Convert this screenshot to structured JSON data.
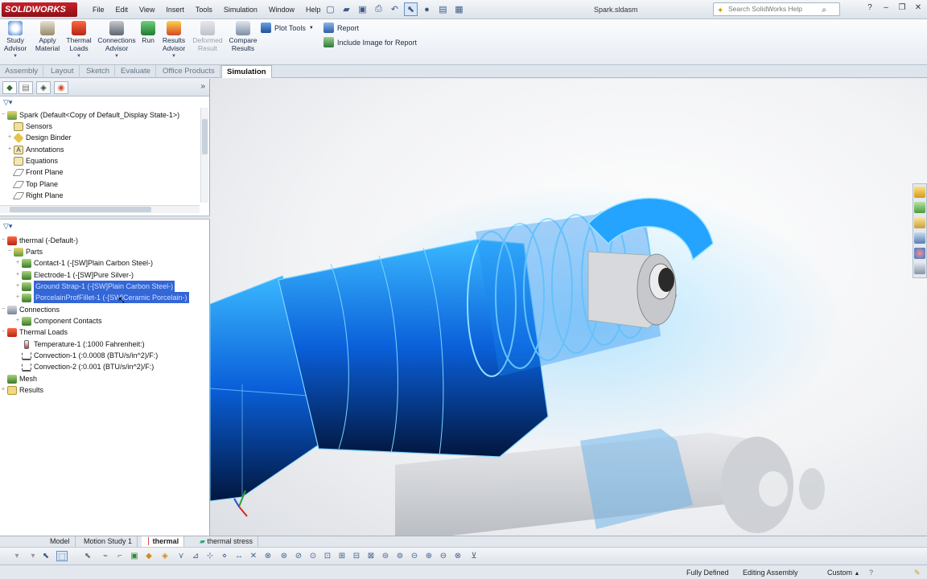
{
  "app": {
    "logo": "SOLIDWORKS",
    "doc_title": "Spark.sldasm"
  },
  "menu": [
    "File",
    "Edit",
    "View",
    "Insert",
    "Tools",
    "Simulation",
    "Window",
    "Help"
  ],
  "search": {
    "placeholder": "Search SolidWorks Help"
  },
  "ribbon": {
    "study_advisor": {
      "l1": "Study",
      "l2": "Advisor"
    },
    "apply_material": {
      "l1": "Apply",
      "l2": "Material"
    },
    "thermal_loads": {
      "l1": "Thermal",
      "l2": "Loads"
    },
    "connections_advisor": {
      "l1": "Connections",
      "l2": "Advisor"
    },
    "run": {
      "l1": "Run"
    },
    "results_advisor": {
      "l1": "Results",
      "l2": "Advisor"
    },
    "deformed_result": {
      "l1": "Deformed",
      "l2": "Result"
    },
    "compare_results": {
      "l1": "Compare",
      "l2": "Results"
    },
    "plot_tools": "Plot Tools",
    "report": "Report",
    "include_image": "Include Image for Report"
  },
  "tabs": [
    "Assembly",
    "Layout",
    "Sketch",
    "Evaluate",
    "Office Products",
    "Simulation"
  ],
  "active_tab": "Simulation",
  "feature_tree": {
    "root": "Spark  (Default<Copy of Default_Display State-1>)",
    "items": [
      "Sensors",
      "Design Binder",
      "Annotations",
      "Equations",
      "Front Plane",
      "Top Plane",
      "Right Plane"
    ]
  },
  "study_tree": {
    "root": "thermal (-Default-)",
    "parts": "Parts",
    "part_items": [
      "Contact-1 (-[SW]Plain Carbon Steel-)",
      "Electrode-1 (-[SW]Pure Silver-)",
      "Ground Strap-1 (-[SW]Plain Carbon Steel-)",
      "PorcelainProfFillet-1 (-[SW]Ceramic Porcelain-)"
    ],
    "connections": "Connections",
    "component_contacts": "Component Contacts",
    "thermal_loads": "Thermal Loads",
    "load_items": [
      "Temperature-1 (:1000 Fahrenheit:)",
      "Convection-1 (:0.0008 (BTU/s/in^2)/F:)",
      "Convection-2 (:0.001 (BTU/s/in^2)/F:)"
    ],
    "mesh": "Mesh",
    "results": "Results"
  },
  "bottom_tabs": [
    "Model",
    "Motion Study 1",
    "thermal",
    "thermal stress"
  ],
  "active_bottom_tab": "thermal",
  "status": {
    "defined": "Fully Defined",
    "mode": "Editing Assembly",
    "units": "Custom"
  },
  "colors": {
    "accent": "#1f6fe0",
    "selection": "#3366d6",
    "model_blue": "#1aa6ff"
  }
}
